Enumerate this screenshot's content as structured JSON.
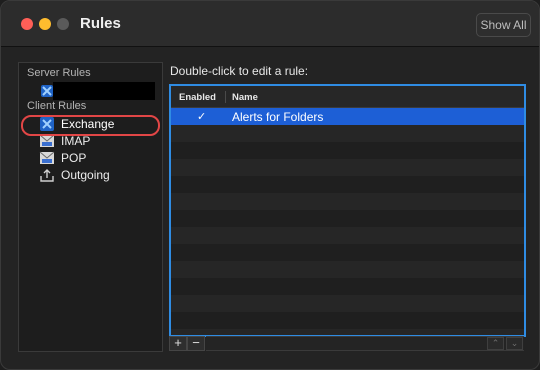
{
  "window": {
    "title": "Rules",
    "show_all_label": "Show All"
  },
  "sidebar": {
    "server_header": "Server Rules",
    "client_header": "Client Rules",
    "server_items": [
      {
        "icon": "exchange-icon",
        "label": ""
      }
    ],
    "client_items": [
      {
        "icon": "exchange-icon",
        "label": "Exchange",
        "selected": true
      },
      {
        "icon": "imap-envelope-icon",
        "label": "IMAP",
        "selected": false
      },
      {
        "icon": "pop-envelope-icon",
        "label": "POP",
        "selected": false
      },
      {
        "icon": "outgoing-tray-icon",
        "label": "Outgoing",
        "selected": false
      }
    ]
  },
  "main": {
    "prompt": "Double-click to edit a rule:",
    "columns": [
      "Enabled",
      "Name"
    ],
    "rows": [
      {
        "enabled": "✓",
        "name": "Alerts for Folders",
        "selected": true
      }
    ]
  },
  "buttons": {
    "add": "+",
    "remove": "−",
    "move_up": "⌃",
    "move_down": "⌄"
  },
  "colors": {
    "selection": "#1d5fd6",
    "focus_ring": "#2f8ce3",
    "annotation_ring": "#e24646",
    "close": "#ff5f57",
    "minimize": "#febc2e"
  }
}
